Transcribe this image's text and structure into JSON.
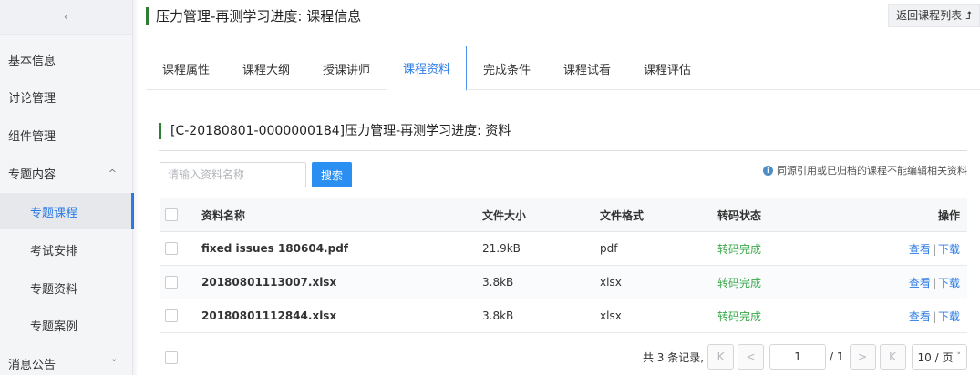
{
  "sidebar": {
    "collapse_glyph": "‹",
    "items": [
      {
        "label": "基本信息"
      },
      {
        "label": "讨论管理"
      },
      {
        "label": "组件管理"
      },
      {
        "label": "专题内容",
        "chevron": "^"
      },
      {
        "label": "专题课程",
        "active": true
      },
      {
        "label": "考试安排"
      },
      {
        "label": "专题资料"
      },
      {
        "label": "专题案例"
      },
      {
        "label": "消息公告",
        "chevron": "˅"
      }
    ]
  },
  "header": {
    "title": "压力管理-再测学习进度: 课程信息",
    "back_label": "返回课程列表 ⮥"
  },
  "tabs": [
    "课程属性",
    "课程大纲",
    "授课讲师",
    "课程资料",
    "完成条件",
    "课程试看",
    "课程评估"
  ],
  "section": {
    "title": "[C-20180801-0000000184]压力管理-再测学习进度: 资料"
  },
  "search": {
    "placeholder": "请输入资料名称",
    "button_label": "搜索"
  },
  "notice": {
    "icon": "info-icon",
    "text": "同源引用或已归档的课程不能编辑相关资料"
  },
  "table": {
    "headers": {
      "name": "资料名称",
      "size": "文件大小",
      "format": "文件格式",
      "status": "转码状态",
      "ops": "操作"
    },
    "rows": [
      {
        "name": "fixed issues 180604.pdf",
        "size": "21.9kB",
        "format": "pdf",
        "status": "转码完成",
        "view": "查看",
        "sep": "|",
        "download": "下载"
      },
      {
        "name": "20180801113007.xlsx",
        "size": "3.8kB",
        "format": "xlsx",
        "status": "转码完成",
        "view": "查看",
        "sep": "|",
        "download": "下载"
      },
      {
        "name": "20180801112844.xlsx",
        "size": "3.8kB",
        "format": "xlsx",
        "status": "转码完成",
        "view": "查看",
        "sep": "|",
        "download": "下载"
      }
    ]
  },
  "pager": {
    "total_text": "共 3 条记录,",
    "first": "K",
    "prev": "<",
    "current_page": "1",
    "total_pages": "/ 1",
    "next": ">",
    "last": "K",
    "page_size": "10 / 页"
  },
  "colors": {
    "accent": "#2c7be5",
    "success": "#3aa94b",
    "title_bar": "#2e7d32"
  }
}
